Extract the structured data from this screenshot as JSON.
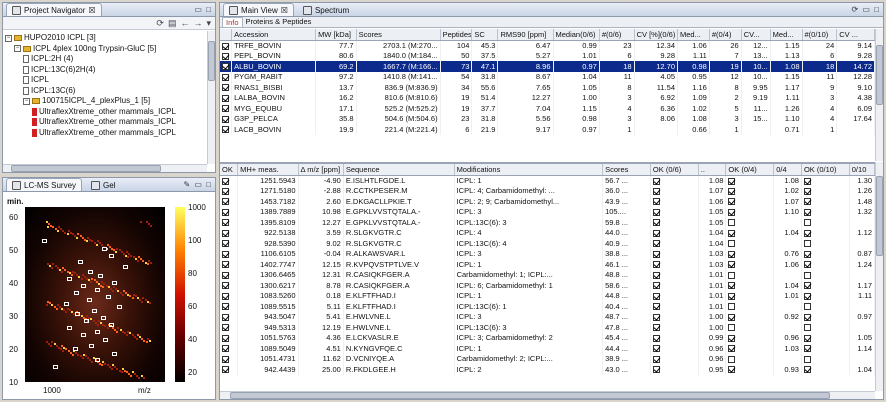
{
  "navigator": {
    "title": "Project Navigator",
    "tab_suffix": "☒",
    "tree": [
      {
        "label": "HUPO2010 ICPL [3]",
        "level": 0,
        "kind": "folder",
        "exp": "−"
      },
      {
        "label": "ICPL 4plex 100ng Trypsin-GluC [5]",
        "level": 1,
        "kind": "folder",
        "exp": "−"
      },
      {
        "label": "ICPL:2H (4)",
        "level": 2,
        "kind": "leaf"
      },
      {
        "label": "ICPL:13C(6)2H(4)",
        "level": 2,
        "kind": "leaf"
      },
      {
        "label": "ICPL",
        "level": 2,
        "kind": "leaf"
      },
      {
        "label": "ICPL:13C(6)",
        "level": 2,
        "kind": "leaf"
      },
      {
        "label": "100715ICPL_4_plexPlus_1 [5]",
        "level": 2,
        "kind": "folder",
        "exp": "−"
      },
      {
        "label": "UltraflexXtreme_other mammals_ICPL",
        "level": 3,
        "kind": "red"
      },
      {
        "label": "UltraflexXtreme_other mammals_ICPL",
        "level": 3,
        "kind": "red"
      },
      {
        "label": "UltraflexXtreme_other mammals_ICPL",
        "level": 3,
        "kind": "red"
      }
    ]
  },
  "survey": {
    "title": "LC-MS Survey",
    "tab2": "Gel",
    "yaxis_label": "min.",
    "xaxis_label": "m/z",
    "x_tick": "1000",
    "y_ticks": [
      "60",
      "50",
      "40",
      "30",
      "20",
      "10"
    ],
    "scale_ticks": [
      "1000",
      "100",
      "80",
      "60",
      "40",
      "20"
    ],
    "spots": [
      [
        0.12,
        0.18
      ],
      [
        0.55,
        0.23
      ],
      [
        0.6,
        0.27
      ],
      [
        0.38,
        0.3
      ],
      [
        0.7,
        0.33
      ],
      [
        0.45,
        0.36
      ],
      [
        0.52,
        0.38
      ],
      [
        0.3,
        0.4
      ],
      [
        0.62,
        0.42
      ],
      [
        0.4,
        0.44
      ],
      [
        0.5,
        0.46
      ],
      [
        0.35,
        0.48
      ],
      [
        0.58,
        0.5
      ],
      [
        0.44,
        0.52
      ],
      [
        0.28,
        0.54
      ],
      [
        0.66,
        0.56
      ],
      [
        0.48,
        0.58
      ],
      [
        0.36,
        0.6
      ],
      [
        0.54,
        0.62
      ],
      [
        0.42,
        0.64
      ],
      [
        0.6,
        0.66
      ],
      [
        0.3,
        0.68
      ],
      [
        0.5,
        0.7
      ],
      [
        0.4,
        0.72
      ],
      [
        0.56,
        0.75
      ],
      [
        0.46,
        0.78
      ],
      [
        0.34,
        0.8
      ],
      [
        0.62,
        0.83
      ],
      [
        0.5,
        0.86
      ],
      [
        0.2,
        0.9
      ]
    ]
  },
  "main": {
    "tab1": "Main View",
    "tab2": "Spectrum",
    "subtab1": "Info",
    "subtab2": "Proteins & Peptides",
    "protein_headers": [
      "",
      "Accession",
      "MW [kDa]",
      "Scores",
      "Peptides",
      "SC",
      "RMS90 [ppm]",
      "Median(0/6)",
      "#(0/6)",
      "CV [%](0/6)",
      "Med...",
      "#(0/4)",
      "CV...",
      "Med...",
      "#(0/10)",
      "CV ..."
    ],
    "proteins": [
      [
        "TRFE_BOVIN",
        "77.7",
        "2703.1 (M:270...",
        "104",
        "45.3",
        "6.47",
        "0.99",
        "23",
        "12.34",
        "1.06",
        "26",
        "12...",
        "1.15",
        "24",
        "9.14"
      ],
      [
        "PEPL_BOVIN",
        "80.6",
        "1840.0 (M:184...",
        "50",
        "37.5",
        "5.27",
        "1.01",
        "6",
        "9.28",
        "1.11",
        "7",
        "13...",
        "1.13",
        "6",
        "9.28"
      ],
      [
        "ALBU_BOVIN",
        "69.2",
        "1667.7 (M:166...",
        "73",
        "47.1",
        "8.96",
        "0.97",
        "18",
        "12.70",
        "0.98",
        "19",
        "10...",
        "1.08",
        "18",
        "14.72"
      ],
      [
        "PYGM_RABIT",
        "97.2",
        "1410.8 (M:141...",
        "54",
        "31.8",
        "8.67",
        "1.04",
        "11",
        "4.05",
        "0.95",
        "12",
        "10...",
        "1.15",
        "11",
        "12.28"
      ],
      [
        "RNAS1_BISBI",
        "13.7",
        "836.9 (M:836.9)",
        "34",
        "55.6",
        "7.65",
        "1.05",
        "8",
        "11.54",
        "1.16",
        "8",
        "9.95",
        "1.17",
        "9",
        "9.10"
      ],
      [
        "LALBA_BOVIN",
        "16.2",
        "810.6 (M:810.6)",
        "19",
        "51.4",
        "12.27",
        "1.00",
        "3",
        "6.92",
        "1.09",
        "2",
        "9.19",
        "1.11",
        "3",
        "4.38"
      ],
      [
        "MYG_EQUBU",
        "17.1",
        "525.2 (M:525.2)",
        "19",
        "37.7",
        "7.04",
        "1.15",
        "4",
        "6.36",
        "1.02",
        "5",
        "11...",
        "1.26",
        "4",
        "6.09"
      ],
      [
        "G3P_PELCA",
        "35.8",
        "504.6 (M:504.6)",
        "23",
        "31.8",
        "5.56",
        "0.98",
        "3",
        "8.06",
        "1.08",
        "3",
        "15...",
        "1.10",
        "4",
        "17.64"
      ],
      [
        "LACB_BOVIN",
        "19.9",
        "221.4 (M:221.4)",
        "6",
        "21.9",
        "9.17",
        "0.97",
        "1",
        "",
        "0.66",
        "1",
        "",
        "0.71",
        "1",
        ""
      ]
    ],
    "peptide_headers": [
      "OK",
      "MH+ meas.",
      "Δ m/z [ppm]",
      "Sequence",
      "Modifications",
      "Scores",
      "OK (0/6)",
      "..",
      "OK (0/4)",
      "0/4",
      "OK (0/10)",
      "0/10"
    ],
    "peptides": [
      [
        "1251.5943",
        "-4.90",
        "E.ISLHTLFGDE.L",
        "ICPL: 1",
        "56.7 ...",
        "1.08",
        "1.08",
        "1.30"
      ],
      [
        "1271.5180",
        "-2.88",
        "R.CCTKPESER.M",
        "ICPL: 4; Carbamidomethyl: ...",
        "36.0 ...",
        "1.07",
        "1.02",
        "1.26"
      ],
      [
        "1453.7182",
        "2.60",
        "E.DKGACLLPKIE.T",
        "ICPL: 2; 9; Carbamidomethyl...",
        "43.9 ...",
        "1.06",
        "1.07",
        "1.48"
      ],
      [
        "1389.7889",
        "10.98",
        "E.GPKLVVSTQTALA.-",
        "ICPL: 3",
        "105....",
        "1.05",
        "1.10",
        "1.32"
      ],
      [
        "1395.8109",
        "12.27",
        "E.GPKLVVSTQTALA.-",
        "ICPL:13C(6): 3",
        "59.8 ...",
        "1.05",
        "",
        ""
      ],
      [
        "922.5138",
        "3.59",
        "R.SLGKVGTR.C",
        "ICPL: 4",
        "44.0 ...",
        "1.04",
        "1.04",
        "1.12"
      ],
      [
        "928.5390",
        "9.02",
        "R.SLGKVGTR.C",
        "ICPL:13C(6): 4",
        "40.9 ...",
        "1.04",
        "",
        ""
      ],
      [
        "1106.6105",
        "-0.04",
        "R.ALKAWSVAR.L",
        "ICPL: 3",
        "38.8 ...",
        "1.03",
        "0.76",
        "0.87"
      ],
      [
        "1402.7747",
        "12.15",
        "R.KVPQVSTPTLVE.V",
        "ICPL: 1",
        "46.1 ...",
        "1.03",
        "1.06",
        "1.24"
      ],
      [
        "1306.6465",
        "12.31",
        "R.CASIQKFGER.A",
        "Carbamidomethyl: 1; ICPL:...",
        "48.8 ...",
        "1.01",
        "",
        ""
      ],
      [
        "1300.6217",
        "8.78",
        "R.CASIQKFGER.A",
        "ICPL: 6; Carbamidomethyl: 1",
        "58.6 ...",
        "1.01",
        "1.04",
        "1.17"
      ],
      [
        "1083.5260",
        "0.18",
        "E.KLFTFHAD.I",
        "ICPL: 1",
        "44.8 ...",
        "1.01",
        "1.01",
        "1.11"
      ],
      [
        "1089.5515",
        "5.11",
        "E.KLFTFHAD.I",
        "ICPL:13C(6): 1",
        "40.4 ...",
        "1.01",
        "",
        ""
      ],
      [
        "943.5047",
        "5.41",
        "E.HWLVNE.L",
        "ICPL: 3",
        "48.7 ...",
        "1.00",
        "0.92",
        "0.97"
      ],
      [
        "949.5313",
        "12.19",
        "E.HWLVNE.L",
        "ICPL:13C(6): 3",
        "47.8 ...",
        "1.00",
        "",
        ""
      ],
      [
        "1051.5763",
        "4.36",
        "E.LCKVASLR.E",
        "ICPL: 3; Carbamidomethyl: 2",
        "45.4 ...",
        "0.99",
        "0.96",
        "1.05"
      ],
      [
        "1089.5049",
        "4.51",
        "N.KYNGVFQE.C",
        "ICPL: 1",
        "44.4 ...",
        "0.96",
        "1.03",
        "1.14"
      ],
      [
        "1051.4731",
        "11.62",
        "D.VCNIYQE.A",
        "Carbamidomethyl: 2; ICPL:...",
        "38.9 ...",
        "0.96",
        "",
        ""
      ],
      [
        "942.4439",
        "25.00",
        "R.FKDLGEE.H",
        "ICPL: 2",
        "43.0 ...",
        "0.95",
        "0.93",
        "1.04"
      ]
    ]
  },
  "colors": {
    "selection": "#0b2a8c",
    "heat_low": "#000000",
    "heat_high": "#ffff40"
  }
}
